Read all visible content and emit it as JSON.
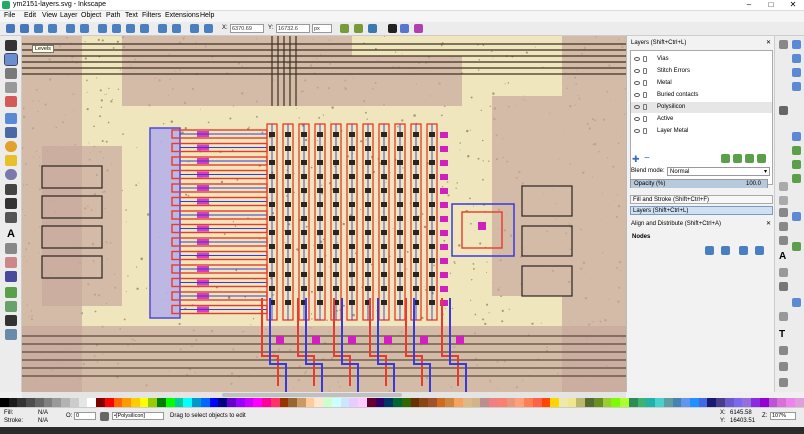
{
  "window": {
    "title": "ym2151-layers.svg - Inkscape",
    "controls": [
      "–",
      "□",
      "✕"
    ]
  },
  "menu": [
    "File",
    "Edit",
    "View",
    "Layer",
    "Object",
    "Path",
    "Text",
    "Filters",
    "Extensions",
    "Help"
  ],
  "toolbar": {
    "x_value": "6370.69",
    "y_value": "16732.6",
    "unit": "px"
  },
  "canvas": {
    "tooltip": "Levels"
  },
  "layers_panel": {
    "header": "Layers (Shift+Ctrl+L)",
    "layers": [
      "Vias",
      "Stitch Errors",
      "Metal",
      "Buried contacts",
      "Polysilicon",
      "Active",
      "Layer Metal"
    ],
    "selected": "Polysilicon",
    "blend_label": "Blend mode:",
    "blend_value": "Normal",
    "opacity_label": "Opacity (%)",
    "opacity_value": "100.0",
    "opacity": 1.0
  },
  "dock_tabs": {
    "fill_stroke": "Fill and Stroke (Shift+Ctrl+F)",
    "layers": "Layers (Shift+Ctrl+L)",
    "align": "Align and Distribute (Shift+Ctrl+A)",
    "nodes_label": "Nodes"
  },
  "status": {
    "fill_label": "Fill:",
    "fill_value": "N/A",
    "stroke_label": "Stroke:",
    "stroke_value": "N/A",
    "o_label": "O:",
    "o_value": "0",
    "layer_select": "•[Polysilicon]",
    "message": "Drag to select objects to edit",
    "x_label": "X:",
    "x_value": "6145.58",
    "y_label": "Y:",
    "y_value": "16403.51",
    "z_label": "Z:",
    "z_value": "107%"
  },
  "colors": {
    "polysilicon": "#e83a2e",
    "metal": "#3a3ad8",
    "via": "#d020c0",
    "active": "#c9a89e",
    "background": "#efe6bd"
  }
}
